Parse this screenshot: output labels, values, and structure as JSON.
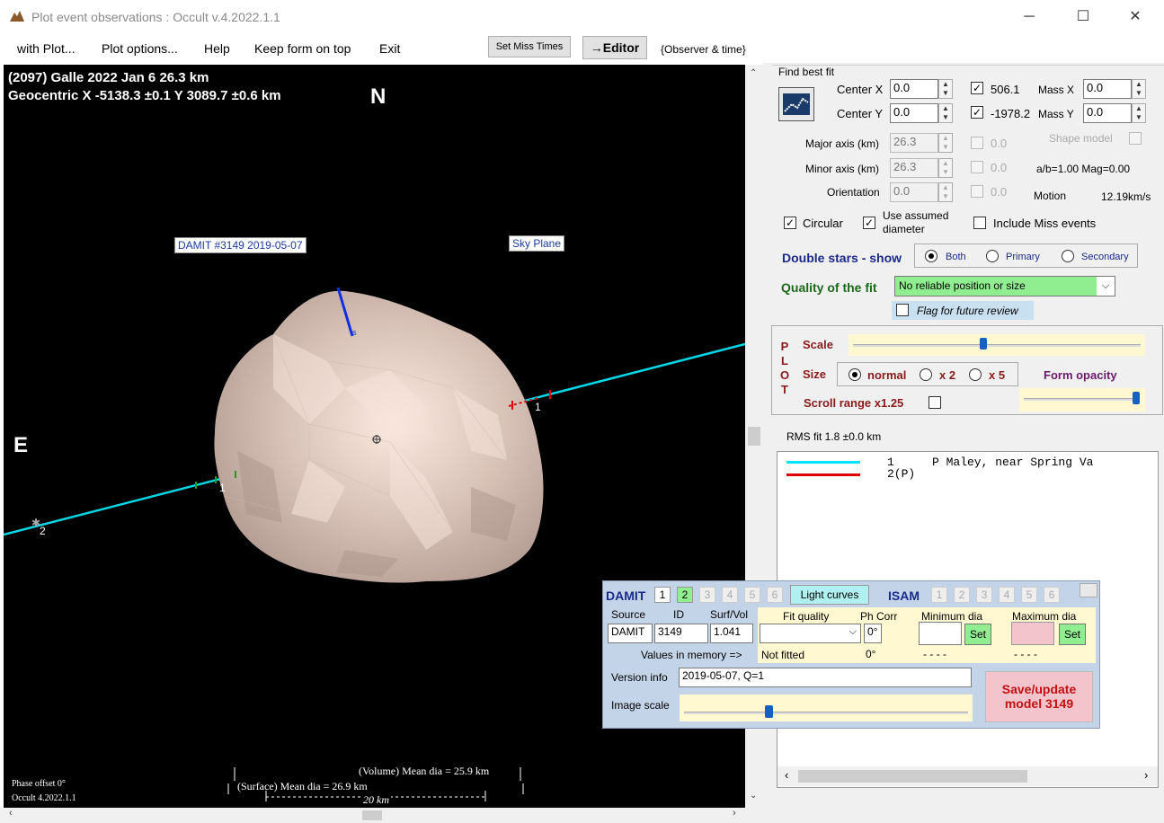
{
  "window": {
    "title": "Plot event observations : Occult v.4.2022.1.1",
    "minimize": "─",
    "maximize": "☐",
    "close": "✕"
  },
  "menu": {
    "items": [
      "with Plot...",
      "Plot options...",
      "Help",
      "Keep form on top",
      "Exit"
    ],
    "set_miss_times": "Set Miss Times",
    "editor": "→Editor",
    "observer_time": "{Observer & time}"
  },
  "plot": {
    "header_line1": "(2097) Galle  2022 Jan 6   26.3 km",
    "header_line2": "Geocentric X  -5138.3 ±0.1  Y 3089.7 ±0.6 km",
    "north": "N",
    "east": "E",
    "damit_label": "DAMIT #3149 2019-05-07",
    "sky_plane": "Sky Plane",
    "chord1_right": "1",
    "chord1_left": "1",
    "chord2_left": "2",
    "pole_label": "s",
    "phase_offset": "Phase offset 0°",
    "occult_version": "Occult 4.2022.1.1",
    "volume_dia": "(Volume) Mean dia = 25.9 km",
    "surface_dia": "(Surface) Mean dia = 26.9 km",
    "scale_bar": "20 km"
  },
  "fit": {
    "title": "Find best fit",
    "center_x_label": "Center X",
    "center_x": "0.0",
    "center_y_label": "Center Y",
    "center_y": "0.0",
    "x_val": "506.1",
    "y_val": "-1978.2",
    "mass_x_label": "Mass X",
    "mass_x": "0.0",
    "mass_y_label": "Mass Y",
    "mass_y": "0.0",
    "major_label": "Major axis (km)",
    "major": "26.3",
    "major_chk": "0.0",
    "minor_label": "Minor axis (km)",
    "minor": "26.3",
    "minor_chk": "0.0",
    "orient_label": "Orientation",
    "orient": "0.0",
    "orient_chk": "0.0",
    "shape_model": "Shape model",
    "ab_mag": "a/b=1.00  Mag=0.00",
    "motion_label": "Motion",
    "motion": "12.19km/s",
    "circular": "Circular",
    "use_assumed": "Use assumed diameter",
    "include_miss": "Include Miss events",
    "double_stars": "Double stars - show",
    "both": "Both",
    "primary": "Primary",
    "secondary": "Secondary",
    "quality_label": "Quality of the fit",
    "quality_value": "No reliable position or size",
    "flag_review": "Flag for future review"
  },
  "plotctl": {
    "plot_letters": [
      "P",
      "L",
      "O",
      "T"
    ],
    "scale": "Scale",
    "size": "Size",
    "normal": "normal",
    "x2": "x 2",
    "x5": "x 5",
    "form_opacity": "Form opacity",
    "scroll_range": "Scroll range x1.25",
    "scale_slider_level": 0.45,
    "opacity_slider_level": 1.0
  },
  "rms": "RMS fit 1.8 ±0.0 km",
  "legend": [
    {
      "num": "1",
      "name": "P Maley, near Spring Va",
      "color": "#00e5ff"
    },
    {
      "num": "2(P)",
      "name": "",
      "color": "#e00000"
    }
  ],
  "damit": {
    "title": "DAMIT",
    "nums": [
      "1",
      "2",
      "3",
      "4",
      "5",
      "6"
    ],
    "light_curves": "Light curves",
    "isam": "ISAM",
    "isam_nums": [
      "1",
      "2",
      "3",
      "4",
      "5",
      "6"
    ],
    "source_label": "Source",
    "id_label": "ID",
    "surf_label": "Surf/Vol",
    "source": "DAMIT",
    "id": "3149",
    "surf": "1.041",
    "fit_quality_label": "Fit quality",
    "phcorr_label": "Ph Corr",
    "min_dia_label": "Minimum dia",
    "max_dia_label": "Maximum dia",
    "phcorr": "0°",
    "set": "Set",
    "values_mem": "Values in memory =>",
    "not_fitted": "Not fitted",
    "phcorr_mem": "0°",
    "dashes": "- - - -",
    "version_label": "Version info",
    "version": "2019-05-07, Q=1",
    "image_scale": "Image scale",
    "image_scale_level": 0.3,
    "save_update": "Save/update model 3149"
  },
  "colors": {
    "chord": "#00d8e8",
    "miss": "#e00000",
    "pole": "#1030e0",
    "accent_green": "#90ee90",
    "save_bg": "#f4c4cc"
  }
}
